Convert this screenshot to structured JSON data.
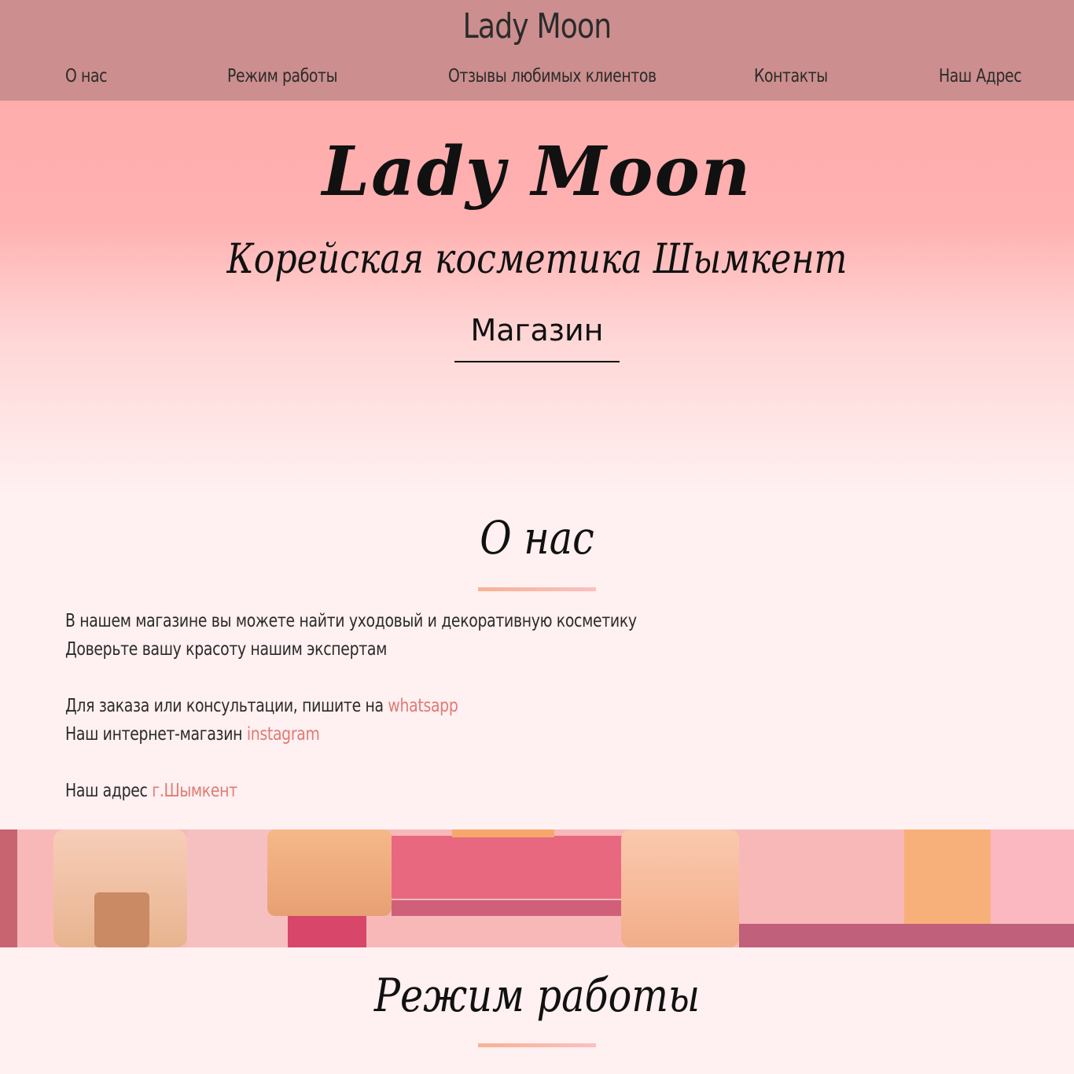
{
  "header": {
    "site_title": "Lady Moon",
    "nav": [
      "О нас",
      "Режим работы",
      "Отзывы любимых клиентов",
      "Контакты",
      "Наш Адрес"
    ]
  },
  "hero": {
    "logo": "Lady Moon",
    "subtitle": "Корейская косметика Шымкент",
    "shop_button": "Магазин"
  },
  "about": {
    "heading": "О нас",
    "line1": "В нашем магазине вы можете найти уходовый и декоративную косметику",
    "line2": "Доверьте вашу красоту нашим экспертам",
    "order_text": "Для заказа или консультации, пишите на ",
    "order_link": "whatsapp",
    "shop_text": "Наш интернет-магазин ",
    "shop_link": "instagram",
    "address_text": "Наш адрес ",
    "address_link": "г.Шымкент"
  },
  "schedule": {
    "heading": "Режим работы"
  },
  "colors": {
    "header_bg": "#cc8e8e",
    "hero_top": "#ffadad",
    "page_bg": "#fff0f1",
    "link": "#e07a74",
    "underline_from": "#f8b294",
    "underline_to": "#fac0c0"
  }
}
